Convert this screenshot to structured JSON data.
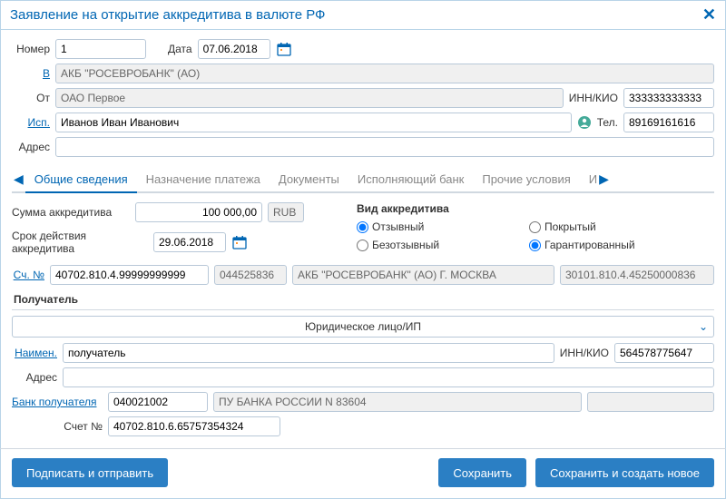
{
  "title": "Заявление на открытие аккредитива в валюте РФ",
  "header": {
    "number_label": "Номер",
    "number": "1",
    "date_label": "Дата",
    "date": "07.06.2018",
    "in_label": "В",
    "in_value": "АКБ \"РОСЕВРОБАНК\" (АО)",
    "from_label": "От",
    "from_value": "ОАО Первое",
    "inn_label": "ИНН/КИО",
    "inn_value": "333333333333",
    "isp_label": "Исп.",
    "isp_value": "Иванов Иван Иванович",
    "tel_label": "Тел.",
    "tel_value": "89169161616",
    "addr_label": "Адрес",
    "addr_value": ""
  },
  "tabs": {
    "items": [
      "Общие сведения",
      "Назначение платежа",
      "Документы",
      "Исполняющий банк",
      "Прочие условия"
    ],
    "trailing": "И"
  },
  "body": {
    "amount_label": "Сумма аккредитива",
    "amount": "100 000,00",
    "currency": "RUB",
    "type_title": "Вид аккредитива",
    "radios": {
      "r1": "Отзывный",
      "r2": "Покрытый",
      "r3": "Безотзывный",
      "r4": "Гарантированный"
    },
    "term_label": "Срок действия аккредитива",
    "term_date": "29.06.2018",
    "acct_label": "Сч. №",
    "acct_value": "40702.810.4.99999999999",
    "bic": "044525836",
    "bank_name": "АКБ \"РОСЕВРОБАНК\" (АО) Г. МОСКВА",
    "corr": "30101.810.4.45250000836"
  },
  "recipient": {
    "title": "Получатель",
    "type_label": "Юридическое лицо/ИП",
    "name_label": "Наимен.",
    "name_value": "получатель",
    "inn_label": "ИНН/КИО",
    "inn_value": "564578775647",
    "addr_label": "Адрес",
    "addr_value": "",
    "bank_label": "Банк получателя",
    "bank_bic": "040021002",
    "bank_name": "ПУ БАНКА РОССИИ N 83604",
    "bank_extra": "",
    "acct_label": "Счет №",
    "acct_value": "40702.810.6.65757354324"
  },
  "footer": {
    "sign": "Подписать и отправить",
    "save": "Сохранить",
    "save_new": "Сохранить и создать новое"
  }
}
